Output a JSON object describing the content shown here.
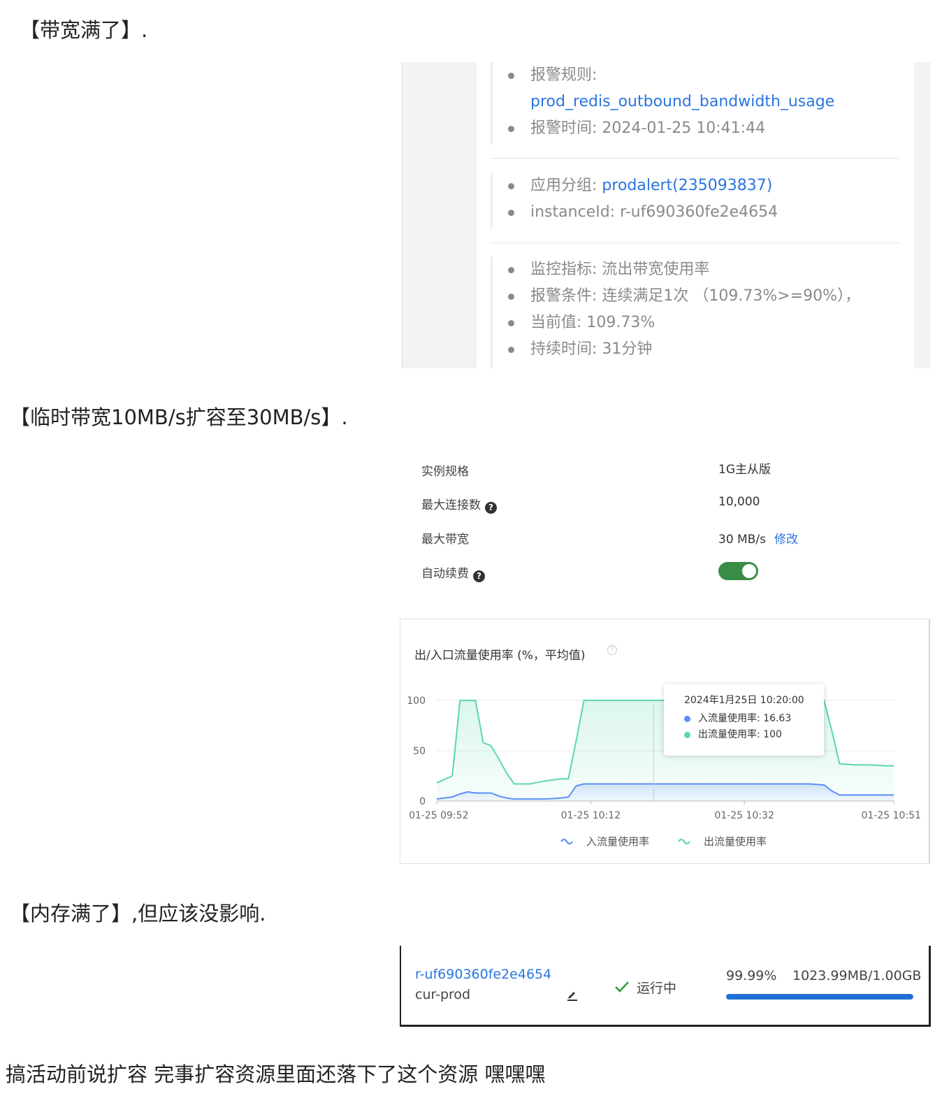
{
  "headings": {
    "h1": "【带宽满了】.",
    "h2": "【临时带宽10MB/s扩容至30MB/s】.",
    "h3": "【内存满了】,但应该没影响.",
    "h4": "搞活动前说扩容 完事扩容资源里面还落下了这个资源  嘿嘿嘿"
  },
  "alert": {
    "rule_label": "报警规则:",
    "rule_value": "prod_redis_outbound_bandwidth_usage",
    "time_label": "报警时间:",
    "time_value": "2024-01-25 10:41:44",
    "group_label": "应用分组:",
    "group_value": "prodalert(235093837)",
    "instance_label": "instanceId:",
    "instance_value": "r-uf690360fe2e4654",
    "metric_label": "监控指标:",
    "metric_value": "流出带宽使用率",
    "condition_label": "报警条件:",
    "condition_value": "连续满足1次 （109.73%>=90%），",
    "current_label": "当前值:",
    "current_value": "109.73%",
    "duration_label": "持续时间:",
    "duration_value": "31分钟"
  },
  "instance_info": {
    "spec_label": "实例规格",
    "spec_value": "1G主从版",
    "maxconn_label": "最大连接数",
    "maxconn_value": "10,000",
    "bandwidth_label": "最大带宽",
    "bandwidth_value": "30 MB/s",
    "modify_label": "修改",
    "autorenew_label": "自动续费",
    "autorenew_on": true,
    "help_glyph": "?"
  },
  "chart_data": {
    "type": "area",
    "title": "出/入口流量使用率 (%，平均值)",
    "xlabel": "",
    "ylabel": "",
    "ylim": [
      0,
      100
    ],
    "yticks": [
      "0",
      "50",
      "100"
    ],
    "x_ticks": [
      "01-25 09:52",
      "01-25 10:12",
      "01-25 10:32",
      "01-25 10:51"
    ],
    "grid": true,
    "legend_position": "bottom",
    "x": [
      "09:52",
      "09:54",
      "09:55",
      "09:56",
      "09:57",
      "09:58",
      "09:59",
      "10:00",
      "10:01",
      "10:02",
      "10:04",
      "10:06",
      "10:08",
      "10:09",
      "10:10",
      "10:11",
      "10:12",
      "10:14",
      "10:16",
      "10:18",
      "10:20",
      "10:22",
      "10:24",
      "10:26",
      "10:28",
      "10:30",
      "10:32",
      "10:34",
      "10:36",
      "10:38",
      "10:40",
      "10:42",
      "10:43",
      "10:44",
      "10:46",
      "10:48",
      "10:50",
      "10:51"
    ],
    "series": [
      {
        "name": "入流量使用率",
        "color": "#5b8ff9",
        "values": [
          2,
          4,
          7,
          9,
          8,
          8,
          8,
          5,
          3,
          2,
          2,
          2,
          3,
          4,
          15,
          17,
          17,
          17,
          17,
          17,
          17,
          17,
          17,
          17,
          17,
          17,
          17,
          17,
          17,
          17,
          17,
          16,
          10,
          6,
          6,
          6,
          6,
          6
        ]
      },
      {
        "name": "出流量使用率",
        "color": "#5ad8a6",
        "values": [
          18,
          25,
          100,
          100,
          100,
          58,
          55,
          42,
          28,
          17,
          17,
          20,
          22,
          22,
          60,
          100,
          100,
          100,
          100,
          100,
          100,
          100,
          100,
          100,
          100,
          100,
          100,
          100,
          100,
          100,
          100,
          100,
          70,
          37,
          36,
          36,
          35,
          35
        ]
      }
    ],
    "tooltip": {
      "title": "2024年1月25日 10:20:00",
      "rows": [
        {
          "label": "入流量使用率: 16.63",
          "color": "#5b8ff9"
        },
        {
          "label": "出流量使用率: 100",
          "color": "#5ad8a6"
        }
      ],
      "x": "10:20"
    }
  },
  "memory": {
    "instance_id": "r-uf690360fe2e4654",
    "instance_name": "cur-prod",
    "status": "运行中",
    "usage_percent_text": "99.99%",
    "usage_text": "1023.99MB/1.00GB",
    "usage_fraction": 0.9999,
    "icons": {
      "edit": "pencil-icon",
      "status": "check-icon"
    }
  }
}
